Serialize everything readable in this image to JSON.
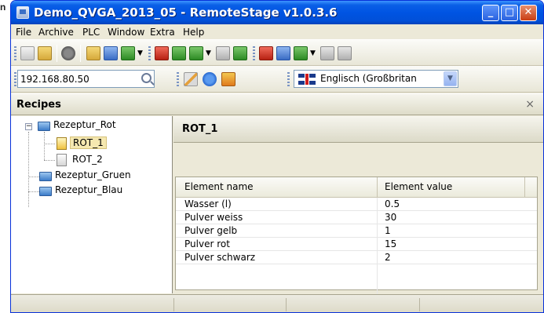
{
  "edge_text": "n",
  "window": {
    "title": "Demo_QVGA_2013_05 - RemoteStage v1.0.3.6",
    "caption_buttons": [
      "minimize-icon",
      "maximize-icon",
      "close-icon"
    ]
  },
  "menu": [
    "File",
    "Archive",
    "PLC",
    "Window",
    "Extra",
    "Help"
  ],
  "toolbar2": {
    "ip_address": "192.168.80.50",
    "language": "Englisch (Großbritan"
  },
  "panel": {
    "title": "Recipes",
    "close_glyph": "×"
  },
  "tree": {
    "root": "Rezeptur_Rot",
    "children": [
      "ROT_1",
      "ROT_2"
    ],
    "siblings": [
      "Rezeptur_Gruen",
      "Rezeptur_Blau"
    ],
    "selected": "ROT_1"
  },
  "detail": {
    "title": "ROT_1",
    "columns": [
      "Element name",
      "Element value"
    ],
    "rows": [
      [
        "Wasser (l)",
        "0.5"
      ],
      [
        "Pulver weiss",
        "30"
      ],
      [
        "Pulver gelb",
        "1"
      ],
      [
        "Pulver rot",
        "15"
      ],
      [
        "Pulver schwarz",
        "2"
      ]
    ]
  },
  "colors": {
    "titlebar": "#0054e3",
    "window_bg": "#ece9d8",
    "selection": "#f5e8b0"
  }
}
